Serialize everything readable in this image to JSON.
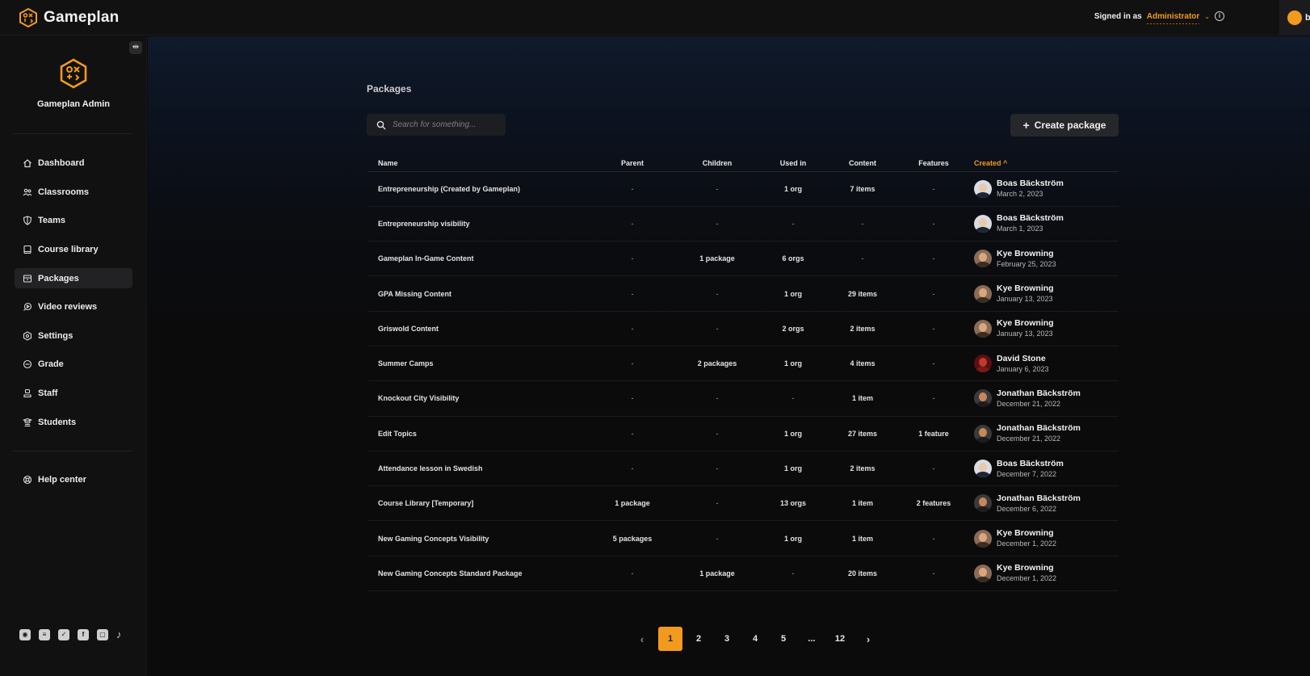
{
  "app": {
    "name": "Gameplan"
  },
  "topbar": {
    "signed_in_label": "Signed in as",
    "role": "Administrator",
    "info_icon": "i",
    "user_initial": "b"
  },
  "sidebar": {
    "org_name": "Gameplan Admin",
    "collapse_icon": "⇹",
    "items": [
      {
        "label": "Dashboard",
        "icon": "home-icon"
      },
      {
        "label": "Classrooms",
        "icon": "users-icon"
      },
      {
        "label": "Teams",
        "icon": "shield-icon"
      },
      {
        "label": "Course library",
        "icon": "book-icon"
      },
      {
        "label": "Packages",
        "icon": "package-icon",
        "active": true
      },
      {
        "label": "Video reviews",
        "icon": "video-icon"
      },
      {
        "label": "Settings",
        "icon": "gear-icon"
      },
      {
        "label": "Grade",
        "icon": "grade-icon"
      },
      {
        "label": "Staff",
        "icon": "staff-icon"
      },
      {
        "label": "Students",
        "icon": "students-icon"
      }
    ],
    "help": {
      "label": "Help center",
      "icon": "lifebuoy-icon"
    },
    "socials": [
      "discord-icon",
      "reddit-icon",
      "twitter-icon",
      "facebook-icon",
      "twitch-icon",
      "tiktok-icon"
    ]
  },
  "main": {
    "title": "Packages",
    "search_placeholder": "Search for something...",
    "create_label": "Create package",
    "columns": {
      "name": "Name",
      "parent": "Parent",
      "children": "Children",
      "used_in": "Used in",
      "content": "Content",
      "features": "Features",
      "created": "Created ^"
    },
    "rows": [
      {
        "name": "Entrepreneurship (Created by Gameplan)",
        "parent": "-",
        "children": "-",
        "used_in": "1 org",
        "content": "7 items",
        "features": "-",
        "creator": "Boas Bäckström",
        "date": "March 2, 2023",
        "avatar": "boas"
      },
      {
        "name": "Entrepreneurship visibility",
        "parent": "-",
        "children": "-",
        "used_in": "-",
        "content": "-",
        "features": "-",
        "creator": "Boas Bäckström",
        "date": "March 1, 2023",
        "avatar": "boas"
      },
      {
        "name": "Gameplan In-Game Content",
        "parent": "-",
        "children": "1 package",
        "used_in": "6 orgs",
        "content": "-",
        "features": "-",
        "creator": "Kye Browning",
        "date": "February 25, 2023",
        "avatar": "kye"
      },
      {
        "name": "GPA Missing Content",
        "parent": "-",
        "children": "-",
        "used_in": "1 org",
        "content": "29 items",
        "features": "-",
        "creator": "Kye Browning",
        "date": "January 13, 2023",
        "avatar": "kye"
      },
      {
        "name": "Griswold Content",
        "parent": "-",
        "children": "-",
        "used_in": "2 orgs",
        "content": "2 items",
        "features": "-",
        "creator": "Kye Browning",
        "date": "January 13, 2023",
        "avatar": "kye"
      },
      {
        "name": "Summer Camps",
        "parent": "-",
        "children": "2 packages",
        "used_in": "1 org",
        "content": "4 items",
        "features": "-",
        "creator": "David Stone",
        "date": "January 6, 2023",
        "avatar": "david"
      },
      {
        "name": "Knockout City Visibility",
        "parent": "-",
        "children": "-",
        "used_in": "-",
        "content": "1 item",
        "features": "-",
        "creator": "Jonathan Bäckström",
        "date": "December 21, 2022",
        "avatar": "jonathan"
      },
      {
        "name": "Edit Topics",
        "parent": "-",
        "children": "-",
        "used_in": "1 org",
        "content": "27 items",
        "features": "1 feature",
        "creator": "Jonathan Bäckström",
        "date": "December 21, 2022",
        "avatar": "jonathan"
      },
      {
        "name": "Attendance lesson in Swedish",
        "parent": "-",
        "children": "-",
        "used_in": "1 org",
        "content": "2 items",
        "features": "-",
        "creator": "Boas Bäckström",
        "date": "December 7, 2022",
        "avatar": "boas"
      },
      {
        "name": "Course Library [Temporary]",
        "parent": "1 package",
        "children": "-",
        "used_in": "13 orgs",
        "content": "1 item",
        "features": "2 features",
        "creator": "Jonathan Bäckström",
        "date": "December 6, 2022",
        "avatar": "jonathan"
      },
      {
        "name": "New Gaming Concepts Visibility",
        "parent": "5 packages",
        "children": "-",
        "used_in": "1 org",
        "content": "1 item",
        "features": "-",
        "creator": "Kye Browning",
        "date": "December 1, 2022",
        "avatar": "kye"
      },
      {
        "name": "New Gaming Concepts Standard Package",
        "parent": "-",
        "children": "1 package",
        "used_in": "-",
        "content": "20 items",
        "features": "-",
        "creator": "Kye Browning",
        "date": "December 1, 2022",
        "avatar": "kye"
      }
    ],
    "pagination": {
      "prev": "‹",
      "next": "›",
      "pages": [
        "1",
        "2",
        "3",
        "4",
        "5",
        "...",
        "12"
      ],
      "current": "1"
    }
  },
  "colors": {
    "accent": "#f19a1e",
    "background": "#0b0b0c",
    "sidebar": "#111112"
  }
}
